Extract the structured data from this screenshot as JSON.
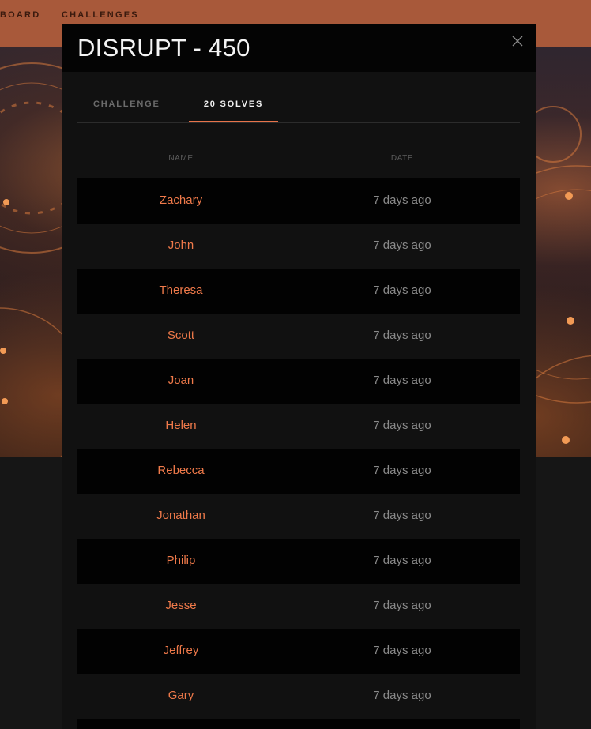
{
  "nav": {
    "scoreboard_label": "BOARD",
    "challenges_label": "CHALLENGES"
  },
  "modal": {
    "title": "DISRUPT - 450",
    "tabs": {
      "challenge_label": "CHALLENGE",
      "solves_label": "20 SOLVES"
    },
    "table": {
      "headers": {
        "name": "NAME",
        "date": "DATE"
      },
      "rows": [
        {
          "name": "Zachary",
          "date": "7 days ago"
        },
        {
          "name": "John",
          "date": "7 days ago"
        },
        {
          "name": "Theresa",
          "date": "7 days ago"
        },
        {
          "name": "Scott",
          "date": "7 days ago"
        },
        {
          "name": "Joan",
          "date": "7 days ago"
        },
        {
          "name": "Helen",
          "date": "7 days ago"
        },
        {
          "name": "Rebecca",
          "date": "7 days ago"
        },
        {
          "name": "Jonathan",
          "date": "7 days ago"
        },
        {
          "name": "Philip",
          "date": "7 days ago"
        },
        {
          "name": "Jesse",
          "date": "7 days ago"
        },
        {
          "name": "Jeffrey",
          "date": "7 days ago"
        },
        {
          "name": "Gary",
          "date": "7 days ago"
        },
        {
          "name": "",
          "date": ""
        }
      ]
    }
  },
  "colors": {
    "accent": "#e8734a",
    "nav_background": "#a8593a",
    "modal_background": "#111111"
  },
  "icons": {
    "close": "close-icon"
  }
}
